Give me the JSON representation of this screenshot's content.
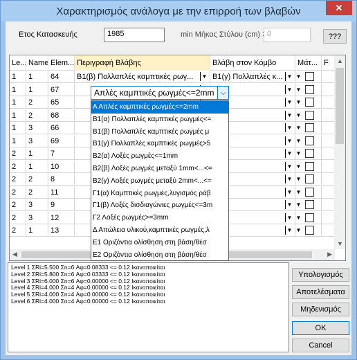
{
  "window": {
    "title": "Χαρακτηρισμός ανάλογα με την επιρροή των βλαβών",
    "close_symbol": "✕"
  },
  "top": {
    "year_label": "Ετος Κατασκευής",
    "year_value": "1985",
    "minlen_label": "min Μήκος Στύλου (cm) >=",
    "minlen_value": "0",
    "help_button": "???"
  },
  "grid": {
    "columns": [
      "Le...",
      "Name",
      "Elem...",
      "Περιγραφή Βλάβης",
      "Βλάβη στον Κόμβο",
      "Μάτ...",
      "F"
    ],
    "rows": [
      {
        "level": "1",
        "name": "1",
        "elem": "64",
        "desc": "Β1(β) Πολλαπλές καμπτικές ρωγ...",
        "node": "Β1(γ) Πολλαπλές κ..."
      },
      {
        "level": "1",
        "name": "1",
        "elem": "67",
        "desc": "",
        "node": ""
      },
      {
        "level": "1",
        "name": "2",
        "elem": "65",
        "desc": "",
        "node": ""
      },
      {
        "level": "1",
        "name": "2",
        "elem": "68",
        "desc": "",
        "node": ""
      },
      {
        "level": "1",
        "name": "3",
        "elem": "66",
        "desc": "",
        "node": ""
      },
      {
        "level": "1",
        "name": "3",
        "elem": "69",
        "desc": "",
        "node": ""
      },
      {
        "level": "2",
        "name": "1",
        "elem": "7",
        "desc": "",
        "node": ""
      },
      {
        "level": "2",
        "name": "1",
        "elem": "10",
        "desc": "",
        "node": ""
      },
      {
        "level": "2",
        "name": "2",
        "elem": "8",
        "desc": "",
        "node": ""
      },
      {
        "level": "2",
        "name": "2",
        "elem": "11",
        "desc": "",
        "node": ""
      },
      {
        "level": "2",
        "name": "3",
        "elem": "9",
        "desc": "",
        "node": ""
      },
      {
        "level": "2",
        "name": "3",
        "elem": "12",
        "desc": "",
        "node": ""
      },
      {
        "level": "2",
        "name": "1",
        "elem": "13",
        "desc": "",
        "node": ""
      }
    ],
    "editor_value": "Απλές καμπτικές ρωγμές<=2mm",
    "dropdown_options": [
      "Α Απλές καμπτικές ρωγμές<=2mm",
      "Β1(α) Πολλαπλές καμπτικές ρωγμές<=",
      "Β1(β) Πολλαπλές καμπτικές ρωγμές μ",
      "Β1(γ) Πολλαπλές καμπτικές ρωγμές>5",
      "Β2(α) Λοξές ρωγμές<=1mm",
      "Β2(β) Λοξές ρωγμές μεταξύ 1mm<...<=",
      "Β2(γ) Λοξές ρωγμές μεταξύ 2mm<...<=",
      "Γ1(α) Καμπτικές ρωγμές,λυγισμός ράβ",
      "Γ1(β) Λοξές δισδιαγώνιες ρωγμές<=3m",
      "Γ2 Λοξές ρωγμές>=3mm",
      "Δ Απώλεια υλικού,καμπτικές ρωγμές,λ",
      "Ε1 Οριζόντια ολίσθηση στη βάση/θέσ",
      "Ε2 Οριζόντια ολίσθηση στη βάση/θέσ"
    ]
  },
  "results": [
    "Level 1 ΣRi=5.500 Σn=6 Αφ=0.08333 <= 0.12 Ικανοποιείται",
    "Level 2 ΣRi=5.800 Σn=6 Αφ=0.03333 <= 0.12 Ικανοποιείται",
    "Level 3 ΣRi=6.000 Σn=6 Αφ=0.00000 <= 0.12 Ικανοποιείται",
    "Level 4 ΣRi=4.000 Σn=4 Αφ=0.00000 <= 0.12 Ικανοποιείται",
    "Level 5 ΣRi=4.000 Σn=4 Αφ=0.00000 <= 0.12 Ικανοποιείται",
    "Level 6 ΣRi=4.000 Σn=4 Αφ=0.00000 <= 0.12 Ικανοποιείται"
  ],
  "buttons": {
    "calculate": "Υπολογισμός",
    "results": "Αποτελέσματα",
    "reset": "Μηδενισμός",
    "ok": "OK",
    "cancel": "Cancel"
  },
  "icons": {
    "combo_arrow": "chevron-down-icon",
    "scroll_up": "arrow-up-icon",
    "scroll_down": "arrow-down-icon",
    "scroll_left": "arrow-left-icon",
    "scroll_right": "arrow-right-icon"
  },
  "colors": {
    "selection": "#0078d7",
    "header_highlight": "#fff2c6",
    "title_bar": "#a9cdf0",
    "close_button": "#c9403a"
  }
}
